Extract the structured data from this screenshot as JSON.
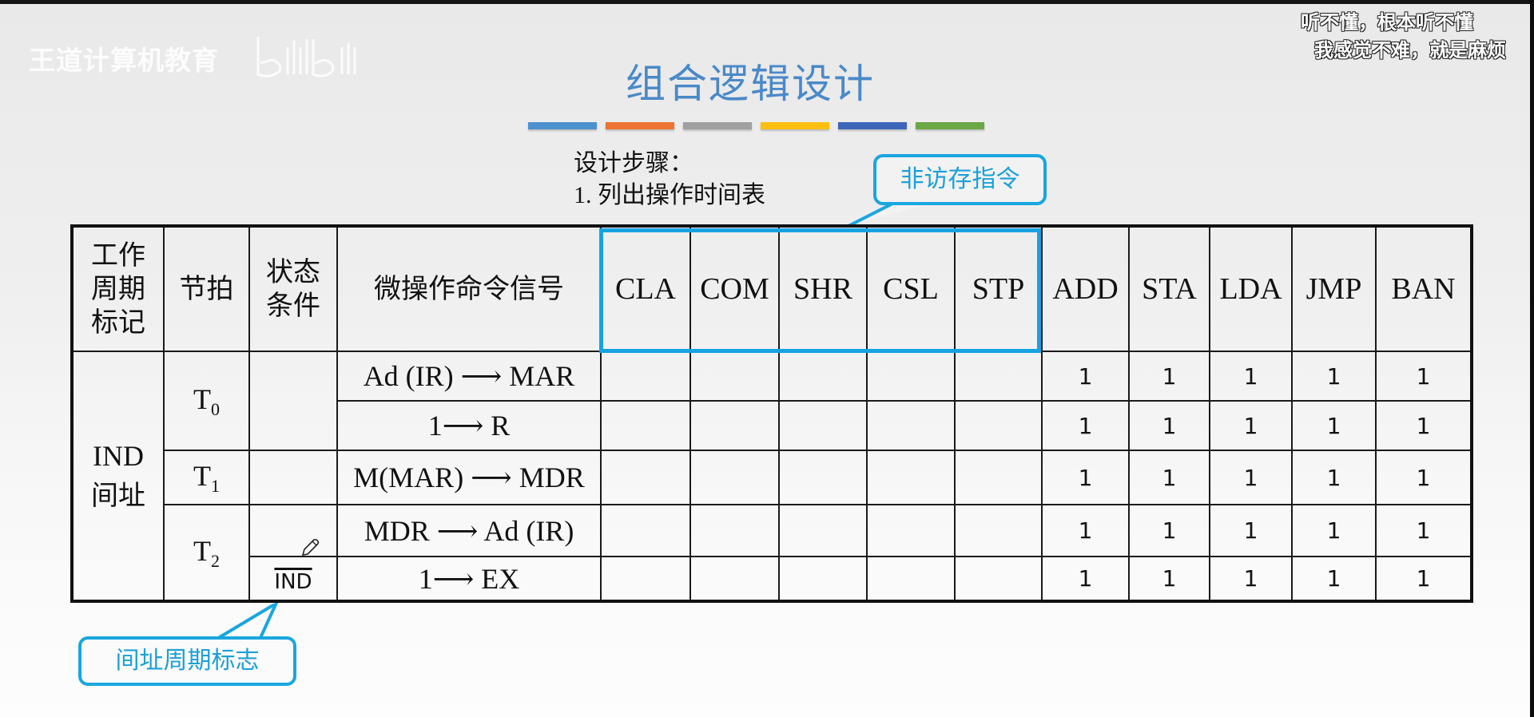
{
  "watermark": {
    "text": "王道计算机教育",
    "logo_icon": "bilibili-logo-icon"
  },
  "danmaku": [
    "听不懂，根本听不懂",
    "我感觉不难，就是麻烦"
  ],
  "slide": {
    "title": "组合逻辑设计",
    "title_color": "#4a89c8",
    "accent_bars": [
      "#4e8fd0",
      "#ed7432",
      "#a0a0a0",
      "#ffbf10",
      "#3d66b9",
      "#6aa745"
    ],
    "steps_heading": "设计步骤：",
    "step_1": "1.  列出操作时间表",
    "callout_top": "非访存指令",
    "callout_bottom": "间址周期标志",
    "callout_color": "#19a6df"
  },
  "table": {
    "headers": {
      "cycle_flag": [
        "工作",
        "周期",
        "标记"
      ],
      "beat": "节拍",
      "condition": [
        "状态",
        "条件"
      ],
      "micro_op": "微操作命令信号",
      "instructions": [
        "CLA",
        "COM",
        "SHR",
        "CSL",
        "STP",
        "ADD",
        "STA",
        "LDA",
        "JMP",
        "BAN"
      ]
    },
    "cycle": {
      "code": "IND",
      "name": "间址"
    },
    "beats": [
      {
        "base": "T",
        "sub": "0"
      },
      {
        "base": "T",
        "sub": "1"
      },
      {
        "base": "T",
        "sub": "2"
      }
    ],
    "condition_ind": "IND",
    "rows": [
      {
        "op": "Ad (IR) ⟶ MAR",
        "values": [
          "",
          "",
          "",
          "",
          "",
          "1",
          "1",
          "1",
          "1",
          "1"
        ]
      },
      {
        "op": "1⟶ R",
        "values": [
          "",
          "",
          "",
          "",
          "",
          "1",
          "1",
          "1",
          "1",
          "1"
        ]
      },
      {
        "op": "M(MAR) ⟶ MDR",
        "values": [
          "",
          "",
          "",
          "",
          "",
          "1",
          "1",
          "1",
          "1",
          "1"
        ]
      },
      {
        "op": "MDR ⟶ Ad (IR)",
        "values": [
          "",
          "",
          "",
          "",
          "",
          "1",
          "1",
          "1",
          "1",
          "1"
        ]
      },
      {
        "op": "1⟶ EX",
        "values": [
          "",
          "",
          "",
          "",
          "",
          "1",
          "1",
          "1",
          "1",
          "1"
        ]
      }
    ]
  }
}
